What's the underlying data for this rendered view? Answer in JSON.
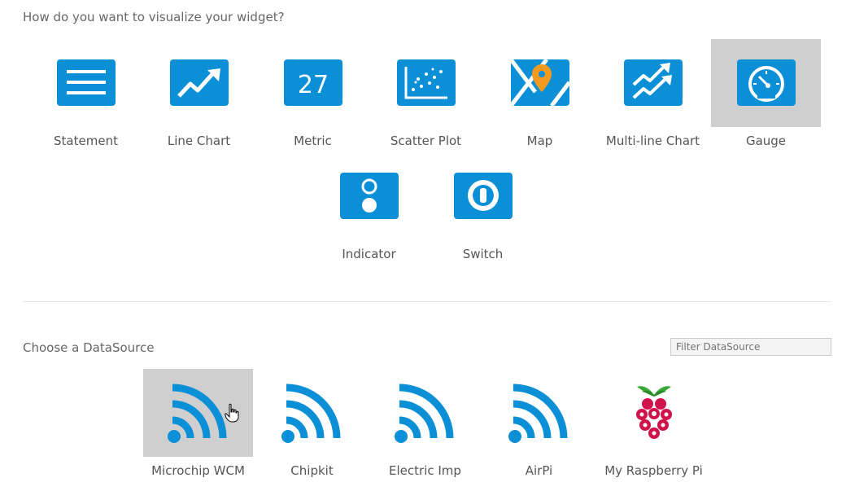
{
  "viz_section": {
    "heading": "How do you want to visualize your widget?"
  },
  "widgets": [
    {
      "label": "Statement",
      "icon": "statement-icon"
    },
    {
      "label": "Line Chart",
      "icon": "line-chart-icon"
    },
    {
      "label": "Metric",
      "icon": "metric-icon",
      "icon_text": "27"
    },
    {
      "label": "Scatter Plot",
      "icon": "scatter-plot-icon"
    },
    {
      "label": "Map",
      "icon": "map-icon"
    },
    {
      "label": "Multi-line Chart",
      "icon": "multi-line-chart-icon"
    },
    {
      "label": "Gauge",
      "icon": "gauge-icon",
      "selected": true
    },
    {
      "label": "Indicator",
      "icon": "indicator-icon"
    },
    {
      "label": "Switch",
      "icon": "switch-icon"
    }
  ],
  "datasource_section": {
    "heading": "Choose a DataSource",
    "filter_placeholder": "Filter DataSource"
  },
  "datasources": [
    {
      "label": "Microchip WCM",
      "icon": "wifi-signal-icon",
      "selected": true
    },
    {
      "label": "Chipkit",
      "icon": "wifi-signal-icon"
    },
    {
      "label": "Electric Imp",
      "icon": "wifi-signal-icon"
    },
    {
      "label": "AirPi",
      "icon": "wifi-signal-icon"
    },
    {
      "label": "My Raspberry Pi",
      "icon": "raspberry-pi-icon"
    }
  ],
  "colors": {
    "accent": "#0b8fd6",
    "selected_bg": "#cfcfcf",
    "raspberry_red": "#d0134a",
    "leaf_green": "#3aa836"
  }
}
